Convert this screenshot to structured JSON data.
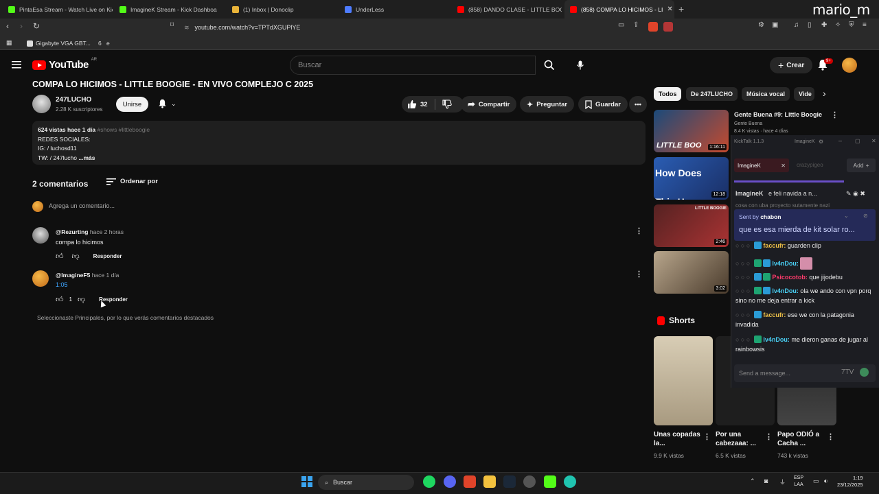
{
  "browser": {
    "tabs": [
      {
        "title": "PintaEsa Stream - Watch Live on Kick",
        "color": "#53fc18"
      },
      {
        "title": "ImagineK Stream - Kick Dashboa",
        "color": "#53fc18"
      },
      {
        "title": "(1) Inbox | Donoclip",
        "color": "#e8b339"
      },
      {
        "title": "UnderLess",
        "color": "#4e7cff"
      },
      {
        "title": "(858) DANDO CLASE - LITTLE BOOGIE",
        "color": "#ff0000"
      },
      {
        "title": "(858) COMPA LO HICIMOS - LI",
        "color": "#ff0000"
      }
    ],
    "url": "youtube.com/watch?v=TPTdXGUPlYE",
    "bookmarks": [
      {
        "label": "Gigabyte VGA GBT..."
      },
      {
        "label": "6"
      },
      {
        "label": "e"
      }
    ],
    "watermark": "mario_m"
  },
  "youtube": {
    "logo_text": "YouTube",
    "logo_country": "AR",
    "search_placeholder": "Buscar",
    "create_label": "Crear",
    "notif_count": "9+"
  },
  "video": {
    "title": "COMPA LO HICIMOS - LITTLE BOOGIE - EN VIVO COMPLEJO C 2025",
    "channel": "247LUCHO",
    "subscribers": "2.28 K suscriptores",
    "join_label": "Unirse",
    "likes": "32",
    "share_label": "Compartir",
    "ask_label": "Preguntar",
    "save_label": "Guardar",
    "desc_meta": "624 vistas  hace 1 día",
    "desc_tags": "#shows #littleboogie",
    "desc_line2": "REDES SOCIALES:",
    "desc_line3": "IG:  / luchosd11",
    "desc_line4": "TW:  / 247lucho",
    "desc_more": "...más"
  },
  "comments": {
    "count_label": "2 comentarios",
    "sort_label": "Ordenar por",
    "add_placeholder": "Agrega un comentario...",
    "items": [
      {
        "author": "@Rezurting",
        "time": "hace 2 horas",
        "text": "compa lo hicimos",
        "likes": "",
        "reply": "Responder",
        "avatar": "#bbbbbb"
      },
      {
        "author": "@ImagineF5",
        "time": "hace 1 día",
        "text": "1:05",
        "likes": "1",
        "reply": "Responder",
        "avatar": "#e08a2a"
      }
    ],
    "footnote": "Seleccionaste Principales, por lo que verás comentarios destacados"
  },
  "sidebar": {
    "chips": [
      "Todos",
      "De 247LUCHO",
      "Música vocal",
      "Vide"
    ],
    "recommended": [
      {
        "title": "Gente Buena #9: Little Boogie",
        "channel": "Gente Buena",
        "meta": "8.4 K vistas · hace 4 días",
        "duration": "1:16:11",
        "caption": "LITTLE BOO",
        "colors": [
          "#1b4a7a",
          "#c44a2e"
        ]
      },
      {
        "title": "",
        "channel": "",
        "meta": "",
        "duration": "12:18",
        "caption": "How Does This Happ",
        "colors": [
          "#2a5db3",
          "#1a2f66"
        ]
      },
      {
        "title": "",
        "channel": "",
        "meta": "",
        "duration": "2:46",
        "caption": "LITTLE BOOGIE",
        "colors": [
          "#552222",
          "#aa3333"
        ]
      },
      {
        "title": "",
        "channel": "",
        "meta": "",
        "duration": "3:02",
        "caption": "",
        "colors": [
          "#b8a68c",
          "#4a3b2c"
        ]
      }
    ],
    "shorts_label": "Shorts",
    "shorts": [
      {
        "title": "Unas copadas la...",
        "views": "9.9 K vistas",
        "color": "#c9bba0"
      },
      {
        "title": "Por una cabezaaa: ...",
        "views": "6.5 K vistas",
        "color": "#222"
      },
      {
        "title": "Papo ODIÓ a Cacha ...",
        "views": "743 k vistas",
        "color": "#2a2a2a"
      }
    ]
  },
  "kick_chat": {
    "window_title": "KickTalk 1.1.3",
    "window_user": "ImagineK",
    "tab_active": "ImagineK",
    "tab_inactive": "crazypigeo",
    "add_label": "Add",
    "pinned_user": "ImagineK",
    "pinned_text": "e feli navida a n...",
    "pinned_sub": "cosa con uba proyecto sutamente nazi",
    "sent_by_label": "Sent by",
    "sent_by_user": "chabon",
    "highlight_text": "que es esa mierda de kit solar ro...",
    "messages": [
      {
        "user": "faccufr:",
        "text": "guarden clip",
        "color": "o"
      },
      {
        "user": "lv4nDou:",
        "text": "",
        "color": ""
      },
      {
        "user": "Psicocotob:",
        "text": "que jijodebu",
        "color": "r"
      },
      {
        "user": "lv4nDou:",
        "text": "ola we ando con vpn porq sino no me deja entrar a kick",
        "color": ""
      },
      {
        "user": "faccufr:",
        "text": "ese we con la patagonia invadida",
        "color": "o"
      },
      {
        "user": "lv4nDou:",
        "text": "me dieron ganas de jugar al rainbowsis",
        "color": ""
      }
    ],
    "input_placeholder": "Send a message..."
  },
  "taskbar": {
    "search_label": "Buscar",
    "lang_1": "ESP",
    "lang_2": "LAA",
    "time": "1:19",
    "date": "23/12/2025"
  }
}
